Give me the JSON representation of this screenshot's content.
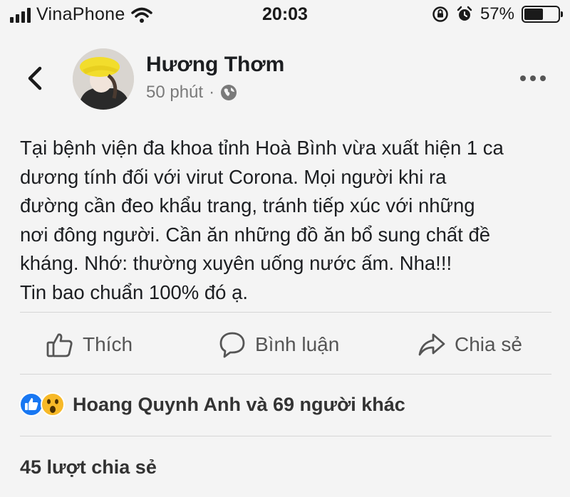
{
  "status_bar": {
    "carrier": "VinaPhone",
    "time": "20:03",
    "battery_percent": "57%",
    "battery_level": 0.57,
    "icons": [
      "signal-icon",
      "wifi-icon",
      "rotation-lock-icon",
      "alarm-icon",
      "battery-icon"
    ]
  },
  "post": {
    "author": "Hương Thơm",
    "time_ago": "50 phút",
    "separator": "·",
    "privacy_icon": "globe-icon",
    "text_lines": [
      "Tại bệnh viện đa khoa tỉnh Hoà Bình vừa xuất hiện 1 ca",
      "dương tính đối với virut Corona. Mọi người khi ra",
      "đường cần đeo khẩu trang, tránh tiếp xúc với những",
      "nơi đông người. Cần ăn những đồ ăn bổ sung chất đề",
      "kháng. Nhớ: thường xuyên uống nước ấm. Nha!!!",
      "Tin bao chuẩn 100% đó ạ."
    ]
  },
  "actions": {
    "like": "Thích",
    "comment": "Bình luận",
    "share": "Chia sẻ"
  },
  "reactions": {
    "types": [
      "like-reaction-icon",
      "wow-reaction-icon"
    ],
    "text": "Hoang Quynh Anh và 69 người khác"
  },
  "shares": {
    "text": "45 lượt chia sẻ"
  },
  "colors": {
    "like_blue": "#1877f2",
    "wow_yellow": "#f7b928",
    "meta_gray": "#7a7a7a"
  }
}
